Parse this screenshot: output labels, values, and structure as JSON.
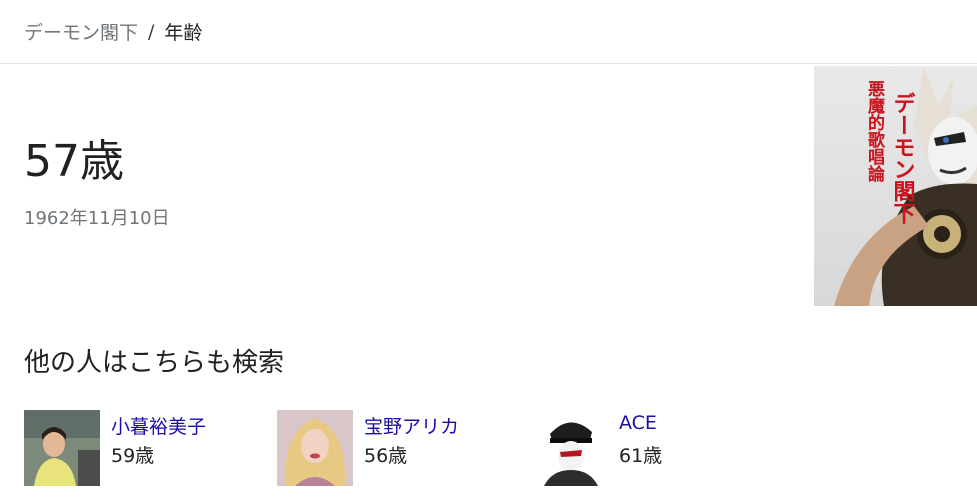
{
  "breadcrumb": {
    "entity": "デーモン閣下",
    "separator": "/",
    "attribute": "年齢"
  },
  "answer": {
    "value": "57歳",
    "birthdate": "1962年11月10日"
  },
  "hero_image": {
    "title_text": "デーモン閣下",
    "subtitle_text": "悪魔的歌唱論"
  },
  "related": {
    "title": "他の人はこちらも検索",
    "people": [
      {
        "name": "小暮裕美子",
        "age": "59歳"
      },
      {
        "name": "宝野アリカ",
        "age": "56歳"
      },
      {
        "name": "ACE",
        "age": "61歳"
      }
    ]
  },
  "colors": {
    "link": "#1a0dab",
    "muted": "#70757a",
    "text": "#202124",
    "hero_title_red": "#c8141e"
  }
}
